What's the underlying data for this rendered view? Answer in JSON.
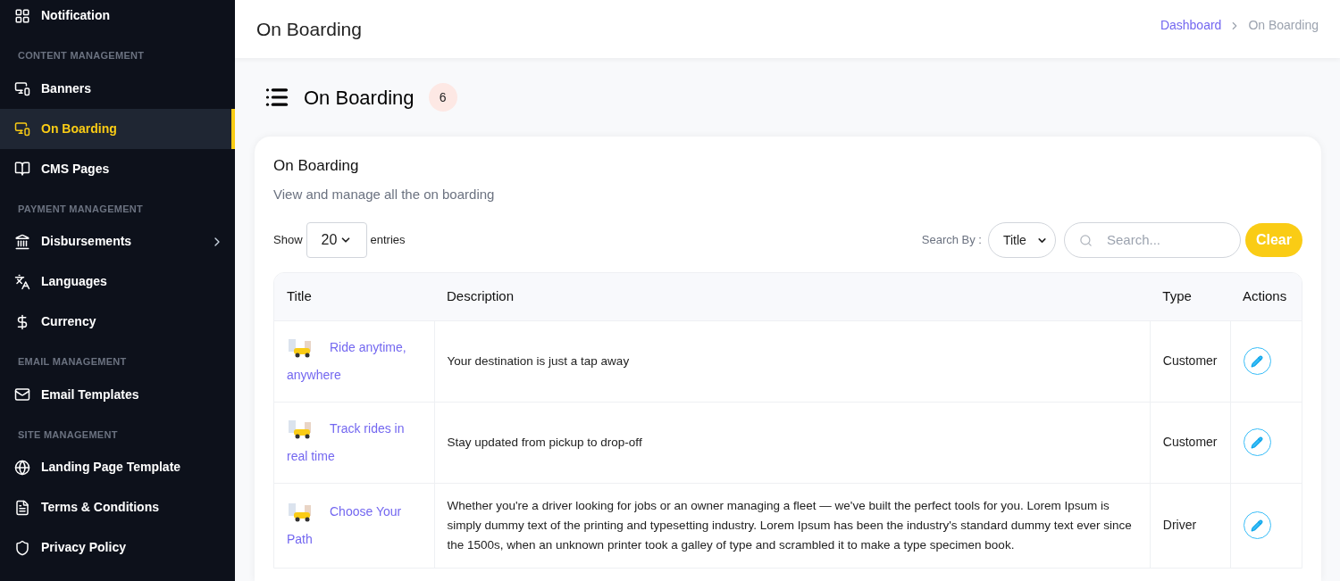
{
  "sidebar": {
    "items": [
      {
        "kind": "item",
        "label": "Notification",
        "selected": false,
        "has_submenu": false
      },
      {
        "kind": "header",
        "label": "CONTENT MANAGEMENT"
      },
      {
        "kind": "item",
        "label": "Banners",
        "selected": false,
        "has_submenu": false
      },
      {
        "kind": "item",
        "label": "On Boarding",
        "selected": true,
        "has_submenu": false
      },
      {
        "kind": "item",
        "label": "CMS Pages",
        "selected": false,
        "has_submenu": false
      },
      {
        "kind": "header",
        "label": "PAYMENT MANAGEMENT"
      },
      {
        "kind": "item",
        "label": "Disbursements",
        "selected": false,
        "has_submenu": true
      },
      {
        "kind": "item",
        "label": "Languages",
        "selected": false,
        "has_submenu": false
      },
      {
        "kind": "item",
        "label": "Currency",
        "selected": false,
        "has_submenu": false
      },
      {
        "kind": "header",
        "label": "EMAIL MANAGEMENT"
      },
      {
        "kind": "item",
        "label": "Email Templates",
        "selected": false,
        "has_submenu": false
      },
      {
        "kind": "header",
        "label": "SITE MANAGEMENT"
      },
      {
        "kind": "item",
        "label": "Landing Page Template",
        "selected": false,
        "has_submenu": false
      },
      {
        "kind": "item",
        "label": "Terms & Conditions",
        "selected": false,
        "has_submenu": false
      },
      {
        "kind": "item",
        "label": "Privacy Policy",
        "selected": false,
        "has_submenu": false
      }
    ]
  },
  "header": {
    "title": "On Boarding",
    "breadcrumb": [
      "Dashboard",
      "On Boarding"
    ]
  },
  "page_title": {
    "title": "On Boarding",
    "count": "6"
  },
  "card": {
    "title": "On Boarding",
    "subtitle": "View and manage all the on boarding",
    "show_label": "Show",
    "entries_value": "20",
    "entries_label": "entries",
    "search_by_label": "Search By :",
    "search_by_value": "Title",
    "search_placeholder": "Search...",
    "clear_button": "Clear"
  },
  "table": {
    "columns": [
      "Title",
      "Description",
      "Type",
      "Actions"
    ],
    "rows": [
      {
        "title": "Ride anytime, anywhere",
        "description": "Your destination is just a tap away",
        "type": "Customer"
      },
      {
        "title": "Track rides in real time",
        "description": "Stay updated from pickup to drop-off",
        "type": "Customer"
      },
      {
        "title": "Choose Your Path",
        "description": "Whether you're a driver looking for jobs or an owner managing a fleet — we've built the perfect tools for you. Lorem Ipsum is simply dummy text of the printing and typesetting industry. Lorem Ipsum has been the industry's standard dummy text ever since the 1500s, when an unknown printer took a galley of type and scrambled it to make a type specimen book.",
        "type": "Driver"
      }
    ]
  }
}
